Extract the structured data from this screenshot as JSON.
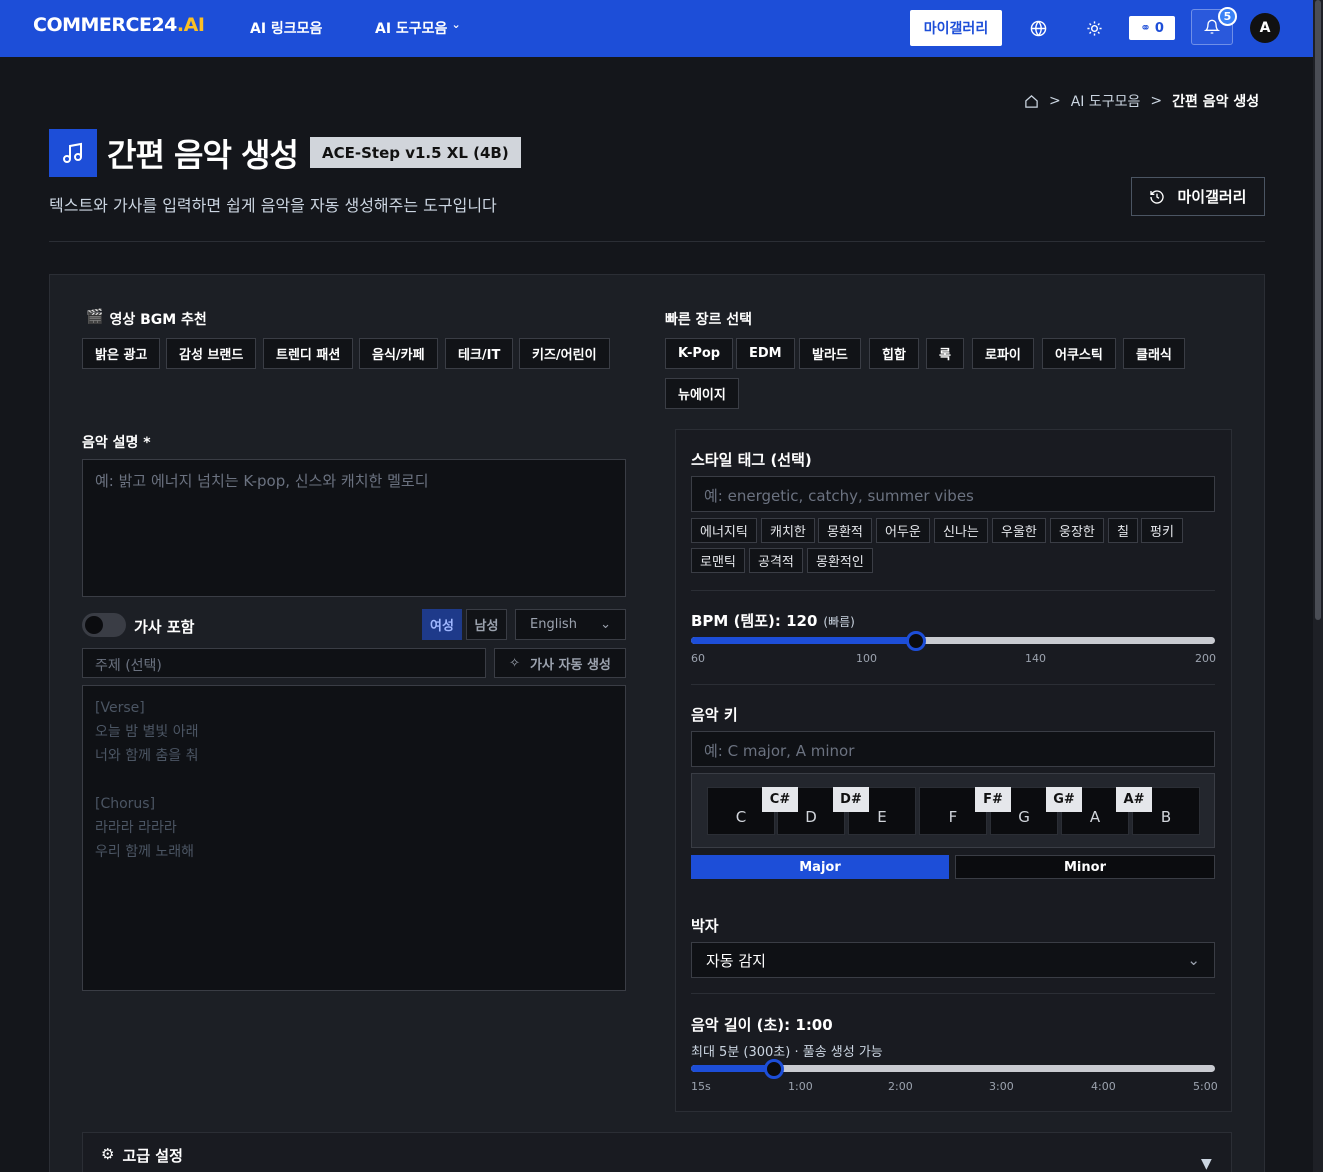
{
  "nav": {
    "logo_a": "COMMERCE24",
    "logo_b": ".AI",
    "links": [
      "AI 링크모음",
      "AI 도구모음"
    ],
    "dropdown_caret": "⌄",
    "gallery": "마이갤러리",
    "credits": "0",
    "notif_count": "5",
    "avatar": "A"
  },
  "breadcrumb": {
    "items": [
      "AI 도구모음",
      "간편 음악 생성"
    ],
    "sep": ">"
  },
  "header": {
    "title": "간편 음악 생성",
    "model": "ACE-Step v1.5 XL (4B)",
    "subtitle": "텍스트와 가사를 입력하면 쉽게 음악을 자동 생성해주는 도구입니다",
    "gallery": "마이갤러리"
  },
  "bgm": {
    "label": "영상 BGM 추천",
    "items": [
      "밝은 광고",
      "감성 브랜드",
      "트렌디 패션",
      "음식/카페",
      "테크/IT",
      "키즈/어린이"
    ]
  },
  "genre": {
    "label": "빠른 장르 선택",
    "items": [
      "K-Pop",
      "EDM",
      "발라드",
      "힙합",
      "록",
      "로파이",
      "어쿠스틱",
      "클래식",
      "뉴에이지"
    ]
  },
  "desc": {
    "label": "음악 설명 *",
    "placeholder": "예: 밝고 에너지 넘치는 K-pop, 신스와 캐치한 멜로디"
  },
  "lyrics": {
    "toggle_label": "가사 포함",
    "female": "여성",
    "male": "남성",
    "language": "English",
    "topic_placeholder": "주제 (선택)",
    "auto_btn": "가사 자동 생성",
    "placeholder_lines": [
      "[Verse]",
      "오늘 밤 별빛 아래",
      "너와 함께 춤을 춰",
      "",
      "[Chorus]",
      "라라라 라라라",
      "우리 함께 노래해"
    ]
  },
  "style": {
    "label": "스타일 태그 (선택)",
    "placeholder": "예: energetic, catchy, summer vibes",
    "tags": [
      "에너지틱",
      "캐치한",
      "몽환적",
      "어두운",
      "신나는",
      "우울한",
      "웅장한",
      "칠",
      "펑키",
      "로맨틱",
      "공격적",
      "몽환적인"
    ]
  },
  "bpm": {
    "label": "BPM (템포): 120",
    "hint": "(빠름)",
    "value": 120,
    "min": 60,
    "max": 200,
    "ticks": [
      "60",
      "100",
      "140",
      "200"
    ]
  },
  "key": {
    "label": "음악 키",
    "placeholder": "예: C major, A minor",
    "white": [
      "C",
      "D",
      "E",
      "F",
      "G",
      "A",
      "B"
    ],
    "black": [
      "C#",
      "D#",
      "F#",
      "G#",
      "A#"
    ],
    "major": "Major",
    "minor": "Minor"
  },
  "meter": {
    "label": "박자",
    "value": "자동 감지"
  },
  "duration": {
    "label": "음악 길이 (초): 1:00",
    "hint": "최대 5분 (300초) · 풀송 생성 가능",
    "value": 60,
    "min": 15,
    "max": 300,
    "ticks": [
      "15s",
      "1:00",
      "2:00",
      "3:00",
      "4:00",
      "5:00"
    ]
  },
  "advanced": {
    "label": "고급 설정",
    "caret": "▼"
  },
  "colors": {
    "accent": "#1d4ed8",
    "bg": "#14161b",
    "panel": "#1c1f25"
  }
}
